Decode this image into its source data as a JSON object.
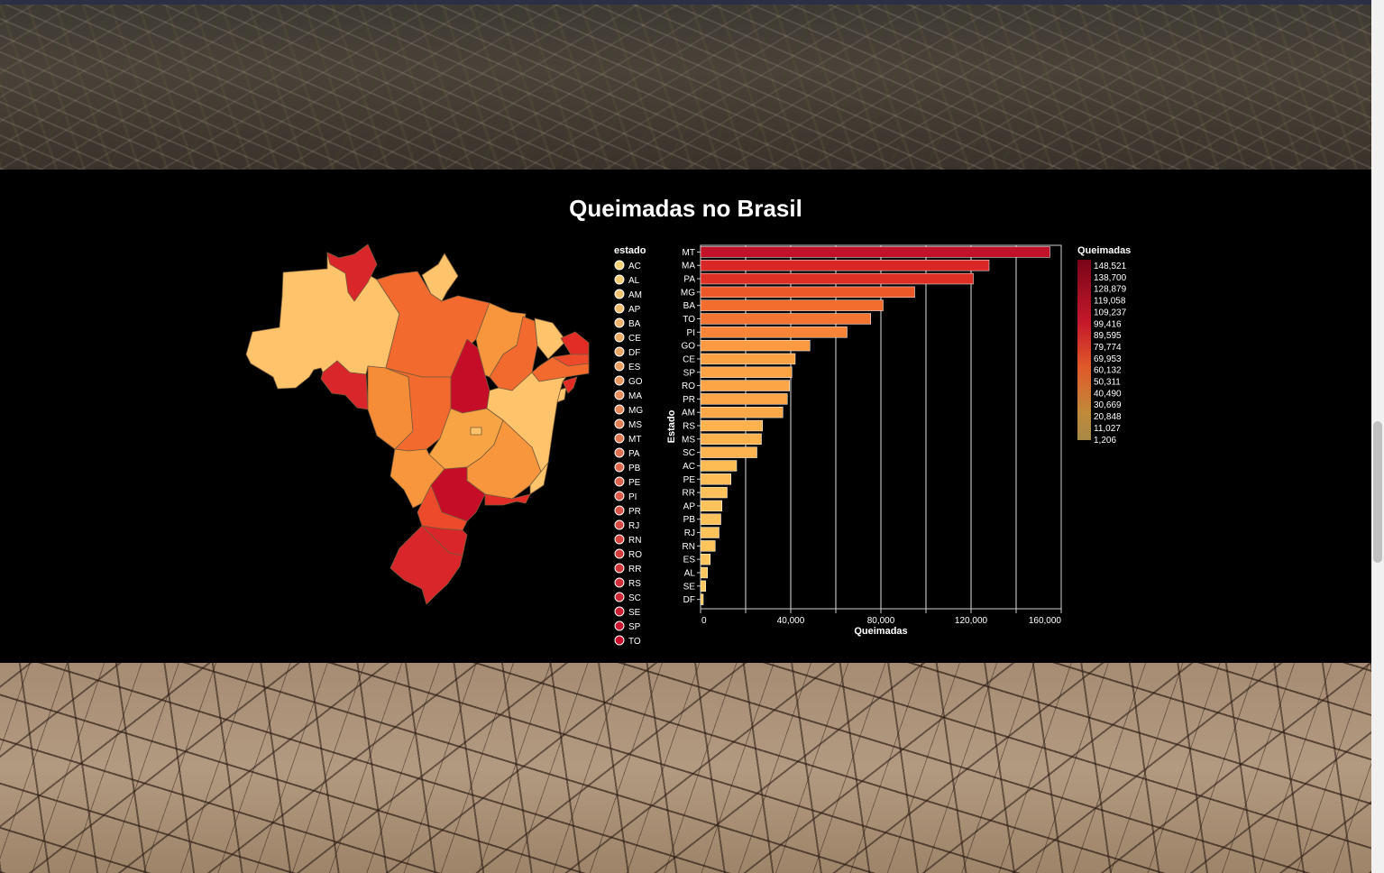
{
  "page": {
    "title": "Queimadas no Brasil"
  },
  "state_legend": {
    "title": "estado",
    "items": [
      "AC",
      "AL",
      "AM",
      "AP",
      "BA",
      "CE",
      "DF",
      "ES",
      "GO",
      "MA",
      "MG",
      "MS",
      "MT",
      "PA",
      "PB",
      "PE",
      "PI",
      "PR",
      "RJ",
      "RN",
      "RO",
      "RR",
      "RS",
      "SC",
      "SE",
      "SP",
      "TO"
    ],
    "color_start": "#f6d275",
    "color_end": "#c8102e"
  },
  "color_legend": {
    "title": "Queimadas",
    "labels": [
      "148,521",
      "138,700",
      "128,879",
      "119,058",
      "109,237",
      "99,416",
      "89,595",
      "79,774",
      "69,953",
      "60,132",
      "50,311",
      "40,490",
      "30,669",
      "20,848",
      "11,027",
      "1,206"
    ],
    "color_high": "#7a0418",
    "color_low": "#a88948"
  },
  "chart_data": {
    "type": "bar",
    "orientation": "horizontal",
    "title": "Queimadas no Brasil",
    "xlabel": "Queimadas",
    "ylabel": "Estado",
    "xlim": [
      0,
      160000
    ],
    "x_ticks": [
      0,
      40000,
      80000,
      120000,
      160000
    ],
    "x_tick_labels": [
      "0",
      "40,000",
      "80,000",
      "120,000",
      "160,000"
    ],
    "grid": "vertical",
    "categories": [
      "MT",
      "MA",
      "PA",
      "MG",
      "BA",
      "TO",
      "PI",
      "GO",
      "CE",
      "SP",
      "RO",
      "PR",
      "AM",
      "RS",
      "MS",
      "SC",
      "AC",
      "PE",
      "RR",
      "AP",
      "PB",
      "RJ",
      "RN",
      "ES",
      "AL",
      "SE",
      "DF"
    ],
    "values": [
      155000,
      128000,
      121000,
      95000,
      81000,
      75500,
      65000,
      48500,
      42000,
      40500,
      39500,
      38500,
      36500,
      27500,
      27000,
      25000,
      16000,
      13500,
      11800,
      9500,
      9000,
      8200,
      6500,
      4300,
      3100,
      2300,
      1206
    ],
    "legend": "right"
  },
  "map_data": {
    "type": "choropleth",
    "regions": [
      {
        "code": "AC",
        "fill": "#d9262a"
      },
      {
        "code": "AM",
        "fill": "#ffc46b"
      },
      {
        "code": "RR",
        "fill": "#d9262a"
      },
      {
        "code": "AP",
        "fill": "#ffc46b"
      },
      {
        "code": "PA",
        "fill": "#f26a2e"
      },
      {
        "code": "RO",
        "fill": "#f58c38"
      },
      {
        "code": "MT",
        "fill": "#f26a2e"
      },
      {
        "code": "TO",
        "fill": "#c50d27"
      },
      {
        "code": "MA",
        "fill": "#f7963c"
      },
      {
        "code": "PI",
        "fill": "#f26a2e"
      },
      {
        "code": "CE",
        "fill": "#ffc46b"
      },
      {
        "code": "RN",
        "fill": "#e22d26"
      },
      {
        "code": "PB",
        "fill": "#ec4a2b"
      },
      {
        "code": "PE",
        "fill": "#f26a2e"
      },
      {
        "code": "AL",
        "fill": "#e22d26"
      },
      {
        "code": "SE",
        "fill": "#ffc46b"
      },
      {
        "code": "BA",
        "fill": "#ffc46b"
      },
      {
        "code": "GO",
        "fill": "#f7a444"
      },
      {
        "code": "DF",
        "fill": "#ffc46b"
      },
      {
        "code": "MS",
        "fill": "#f7963c"
      },
      {
        "code": "MG",
        "fill": "#f7963c"
      },
      {
        "code": "ES",
        "fill": "#ffc46b"
      },
      {
        "code": "SP",
        "fill": "#c50d27"
      },
      {
        "code": "RJ",
        "fill": "#e22d26"
      },
      {
        "code": "PR",
        "fill": "#ec4a2b"
      },
      {
        "code": "SC",
        "fill": "#d9262a"
      },
      {
        "code": "RS",
        "fill": "#d9262a"
      }
    ]
  }
}
